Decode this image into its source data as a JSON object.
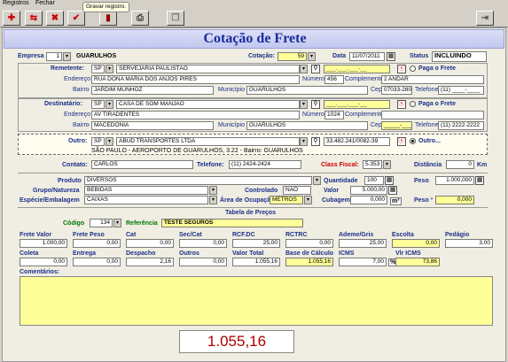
{
  "menu": {
    "registros": "Registros",
    "fechar": "Fechar"
  },
  "tooltip": "Gravar registro.",
  "title": "Cotação de Frete",
  "header": {
    "empresa_label": "Empresa",
    "empresa_code": "1",
    "empresa_name": "GUARULHOS",
    "cotacao_label": "Cotação:",
    "cotacao_value": "59",
    "data_label": "Data",
    "data_value": "11/07/2011",
    "status_label": "Status",
    "status_value": "INCLUINDO"
  },
  "remetente": {
    "label": "Remetente:",
    "uf": "SP",
    "nome": "SERVEJARIA PAULISTÃO",
    "cnpj": "___.___.___-__",
    "paga_label": "Paga o Frete",
    "endereco_label": "Endereço",
    "endereco": "RUA DONA MARIA DOS ANJOS PIRES",
    "numero_label": "Número",
    "numero": "456",
    "complemento_label": "Complemento",
    "complemento": "2 ANDAR",
    "bairro_label": "Bairro",
    "bairro": "JARDIM MUNHOZ",
    "municipio_label": "Município",
    "municipio": "GUARULHOS",
    "cep_label": "Cep",
    "cep": "07033-280",
    "telefone_label": "Telefone",
    "telefone": "(11) ____-____"
  },
  "destinatario": {
    "label": "Destinatário:",
    "uf": "SP",
    "nome": "CASA DE SOM MANJÃO",
    "cnpj": "___.___.___-__",
    "paga_label": "Paga o Frete",
    "endereco_label": "Endereço",
    "endereco": "AV TIRADENTES",
    "numero_label": "Número",
    "numero": "1024",
    "complemento_label": "Complemento",
    "complemento": "",
    "bairro_label": "Bairro",
    "bairro": "MACEDONIA",
    "municipio_label": "Município",
    "municipio": "GUARULHOS",
    "cep_label": "Cep",
    "cep": "_____-___",
    "telefone_label": "Telefone",
    "telefone": "(11) 2222-2222"
  },
  "outro": {
    "label": "Outro:",
    "uf": "SP",
    "nome": "ABUD TRANSPORTES LTDA",
    "cnpj": "33.482.241/0082-39",
    "opt_label": "Outro...",
    "endereco": "SÃO PAULO - AEROPORTO DE GUARULHOS, 3.22 - Bairro: GUARULHOS"
  },
  "contato": {
    "contato_label": "Contato:",
    "contato": "CARLOS",
    "telefone_label": "Telefone:",
    "telefone": "(11) 2424-2424",
    "classfiscal_label": "Class Fiscal:",
    "classfiscal": "5.353",
    "distancia_label": "Distância",
    "distancia": "0",
    "km": "Km"
  },
  "produto": {
    "produto_label": "Produto",
    "produto": "DIVERSOS",
    "quantidade_label": "Quantidade",
    "quantidade": "100",
    "peso_label": "Peso",
    "peso": "1.000,000",
    "grupo_label": "Grupo/Natureza",
    "grupo": "BEBIDAS",
    "controlado_label": "Controlado",
    "controlado": "NÃO",
    "valor_label": "Valor",
    "valor": "5.000,00",
    "especie_label": "Espécie/Embalagem",
    "especie": "CAIXAS",
    "area_label": "Área de Ocupação",
    "area": "METROS",
    "cubagem_label": "Cubagem",
    "cubagem": "0,000",
    "m3": "m³",
    "peso3_label": "Peso ³",
    "peso3": "0,000"
  },
  "tabela": {
    "title": "Tabela de Preços",
    "codigo_label": "Código",
    "codigo": "134",
    "referencia_label": "Referência",
    "referencia": "TESTE SEGUROS"
  },
  "valores": {
    "frete_valor_label": "Frete Valor",
    "frete_valor": "1.000,00",
    "frete_peso_label": "Frete Peso",
    "frete_peso": "0,00",
    "cat_label": "Cat",
    "cat": "0,00",
    "sec_cat_label": "Sec/Cat",
    "sec_cat": "0,00",
    "rcf_dc_label": "RCF.DC",
    "rcf_dc": "25,00",
    "rctrc_label": "RCTRC",
    "rctrc": "0,00",
    "ademe_label": "Ademe/Gris",
    "ademe": "25,00",
    "escolta_label": "Escolta",
    "escolta": "0,00",
    "pedagio_label": "Pedágio",
    "pedagio": "3,00",
    "coleta_label": "Coleta",
    "coleta": "0,00",
    "entrega_label": "Entrega",
    "entrega": "0,00",
    "despacho_label": "Despacho",
    "despacho": "2,16",
    "outros_label": "Outros",
    "outros": "0,00",
    "valor_total_label": "Valor Total",
    "valor_total": "1.055,16",
    "base_calc_label": "Base de Cálculo",
    "base_calc": "1.055,16",
    "icms_label": "ICMS",
    "icms": "7,00",
    "pct": "%",
    "vlr_icms_label": "Vlr ICMS",
    "vlr_icms": "73,86"
  },
  "comentarios_label": "Comentários:",
  "total": "1.055,16"
}
